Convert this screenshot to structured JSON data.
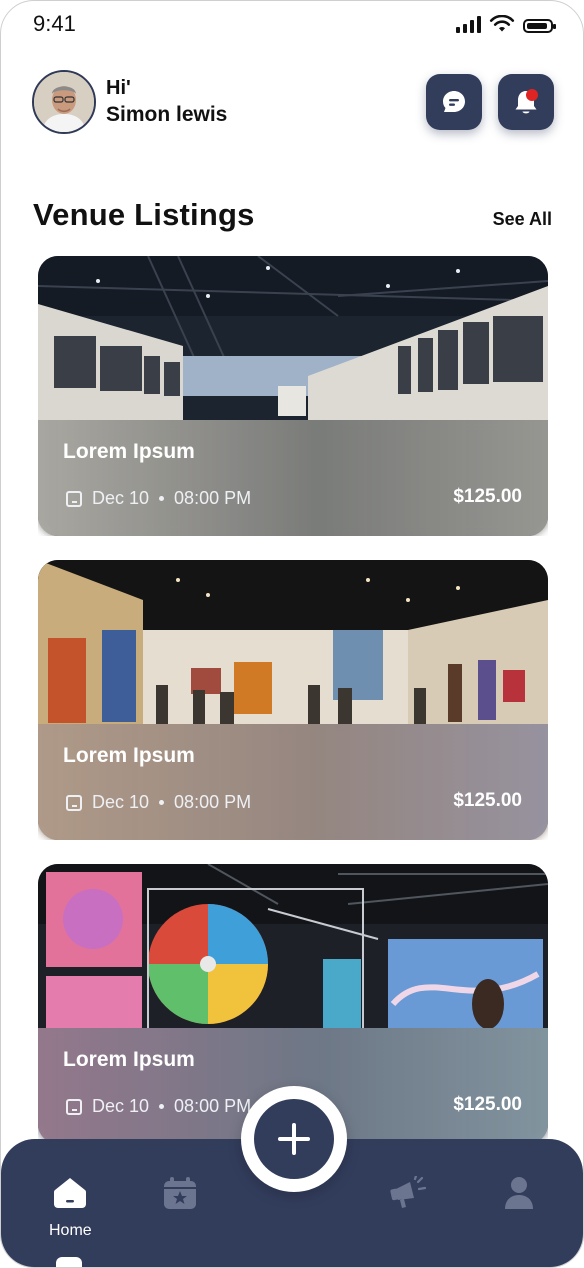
{
  "status_bar": {
    "time": "9:41",
    "icons": [
      "signal-icon",
      "wifi-icon",
      "battery-icon"
    ]
  },
  "header": {
    "greeting": "Hi'",
    "user_name": "Simon lewis",
    "avatar_icon": "user-avatar",
    "actions": [
      "chat-icon",
      "bell-icon"
    ],
    "notification_dot_color": "#e02424"
  },
  "section": {
    "title": "Venue Listings",
    "see_all": "See All"
  },
  "listings": [
    {
      "title": "Lorem Ipsum",
      "date": "Dec 10",
      "time": "08:00 PM",
      "price": "$125.00"
    },
    {
      "title": "Lorem Ipsum",
      "date": "Dec 10",
      "time": "08:00 PM",
      "price": "$125.00"
    },
    {
      "title": "Lorem Ipsum",
      "date": "Dec 10",
      "time": "08:00 PM",
      "price": "$125.00"
    }
  ],
  "nav": {
    "items": [
      {
        "label": "Home",
        "icon": "home-icon",
        "active": true
      },
      {
        "label": "",
        "icon": "calendar-star-icon",
        "active": false
      },
      {
        "label": "",
        "icon": "megaphone-icon",
        "active": false
      },
      {
        "label": "",
        "icon": "profile-icon",
        "active": false
      }
    ],
    "fab_icon": "plus-icon"
  },
  "colors": {
    "primary": "#323d5c",
    "background": "#ffffff",
    "text": "#111111",
    "inactive_icon": "#6c7590"
  }
}
